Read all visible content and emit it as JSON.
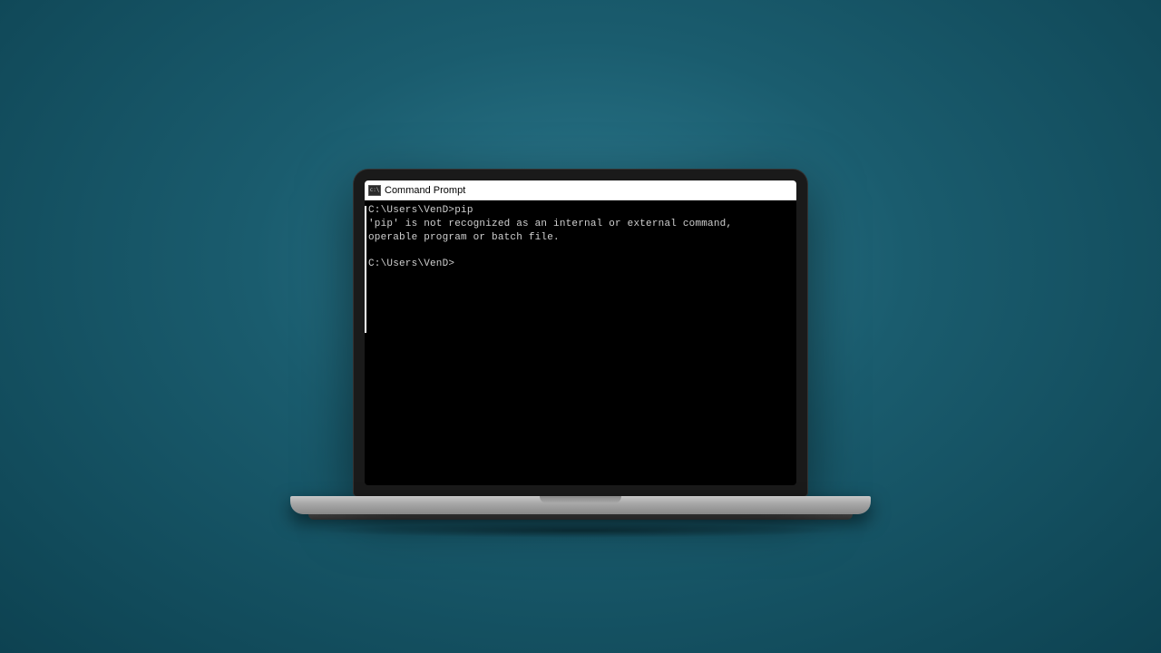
{
  "window": {
    "title": "Command Prompt",
    "icon_name": "cmd-icon"
  },
  "terminal": {
    "lines": [
      "C:\\Users\\VenD>pip",
      "'pip' is not recognized as an internal or external command,",
      "operable program or batch file.",
      "",
      "C:\\Users\\VenD>"
    ],
    "prompt1": "C:\\Users\\VenD>pip",
    "error1": "'pip' is not recognized as an internal or external command,",
    "error2": "operable program or batch file.",
    "prompt2": "C:\\Users\\VenD>"
  }
}
